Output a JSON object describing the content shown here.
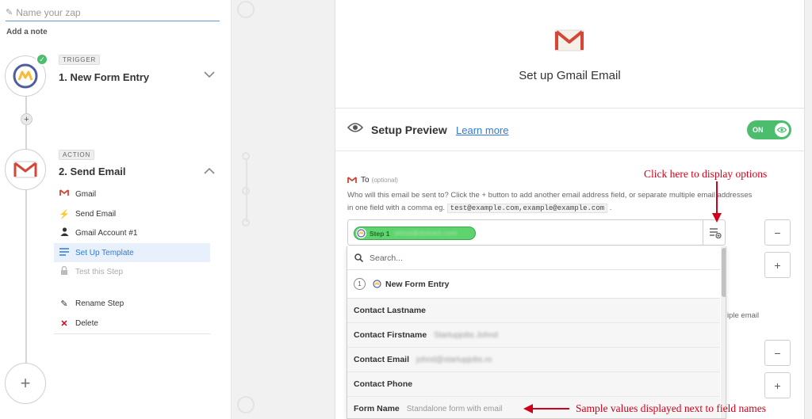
{
  "sidebar": {
    "zap_name_placeholder": "Name your zap",
    "add_note": "Add a note",
    "trigger": {
      "tag": "TRIGGER",
      "title": "1. New Form Entry"
    },
    "action": {
      "tag": "ACTION",
      "title": "2. Send Email"
    },
    "substeps": [
      {
        "label": "Gmail",
        "icon": "gmail-icon"
      },
      {
        "label": "Send Email",
        "icon": "bolt-icon"
      },
      {
        "label": "Gmail Account #1",
        "icon": "user-icon"
      },
      {
        "label": "Set Up Template",
        "icon": "list-icon",
        "active": true
      },
      {
        "label": "Test this Step",
        "icon": "lock-icon",
        "disabled": true
      }
    ],
    "rename_step": "Rename Step",
    "delete": "Delete"
  },
  "panel": {
    "title": "Set up Gmail Email",
    "preview_title": "Setup Preview",
    "learn_more": "Learn more",
    "toggle_label": "ON",
    "to_field": {
      "label": "To",
      "optional": "(optional)",
      "help_1": "Who will this email be sent to? Click the + button to add another email address field, or separate multiple email addresses",
      "help_2": "in one field with a comma eg.",
      "example": "test@example.com,example@example.com",
      "help_end": ".",
      "pill_label": "Step 1",
      "pill_value": "johnd@domain.com"
    },
    "hidden_text": "iple email",
    "buttons": {
      "minus": "−",
      "plus": "+"
    }
  },
  "dropdown": {
    "search_placeholder": "Search...",
    "group_number": "1",
    "group_label": "New Form Entry",
    "rows": [
      {
        "field": "Contact Lastname",
        "sample": ""
      },
      {
        "field": "Contact Firstname",
        "sample": "Startupjobs Johnd",
        "blurred": true
      },
      {
        "field": "Contact Email",
        "sample": "johnd@startupjobs.ro",
        "blurred": true
      },
      {
        "field": "Contact Phone",
        "sample": ""
      },
      {
        "field": "Form Name",
        "sample": "Standalone form with email"
      }
    ]
  },
  "annotations": {
    "options": "Click here to display options",
    "samples": "Sample values displayed next to field names"
  },
  "colors": {
    "accent_blue": "#2f7ad8",
    "success_green": "#4bbd6c",
    "gmail_red": "#d44638",
    "annotation_red": "#d0021b"
  }
}
